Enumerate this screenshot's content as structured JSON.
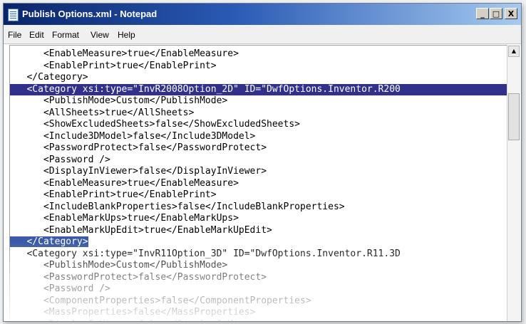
{
  "window": {
    "title": "Publish Options.xml - Notepad",
    "controls": {
      "minimize": "_",
      "maximize": "□",
      "close": "X"
    }
  },
  "menu": [
    "File",
    "Edit",
    "Format",
    "View",
    "Help"
  ],
  "editor": {
    "lines": [
      "      <EnableMeasure>true</EnableMeasure>",
      "      <EnablePrint>true</EnablePrint>",
      "   </Category>",
      "   <Category xsi:type=\"InvR2008Option_2D\" ID=\"DwfOptions.Inventor.R200",
      "      <PublishMode>Custom</PublishMode>",
      "      <AllSheets>true</AllSheets>",
      "      <ShowExcludedSheets>false</ShowExcludedSheets>",
      "      <Include3DModel>false</Include3DModel>",
      "      <PasswordProtect>false</PasswordProtect>",
      "      <Password />",
      "      <DisplayInViewer>false</DisplayInViewer>",
      "      <EnableMeasure>true</EnableMeasure>",
      "      <EnablePrint>true</EnablePrint>",
      "      <IncludeBlankProperties>false</IncludeBlankProperties>",
      "      <EnableMarkUps>true</EnableMarkUps>",
      "      <EnableMarkUpEdit>true</EnableMarkUpEdit>",
      "   </Category>",
      "   <Category xsi:type=\"InvR11Option_3D\" ID=\"DwfOptions.Inventor.R11.3D",
      "      <PublishMode>Custom</PublishMode>",
      "      <PasswordProtect>false</PasswordProtect>",
      "      <Password />",
      "      <ComponentProperties>false</ComponentProperties>",
      "      <MassProperties>false</MassProperties>",
      "      <DisplayInViewer>false</DisplayInViewer>"
    ],
    "selected_line_index": 3,
    "highlighted_line_index": 16
  },
  "scrollbar": {
    "up_arrow": "▲"
  },
  "colors": {
    "selection": "#31318c",
    "secondary_highlight": "#3b5ba8",
    "title_bar": "#0a246a"
  }
}
